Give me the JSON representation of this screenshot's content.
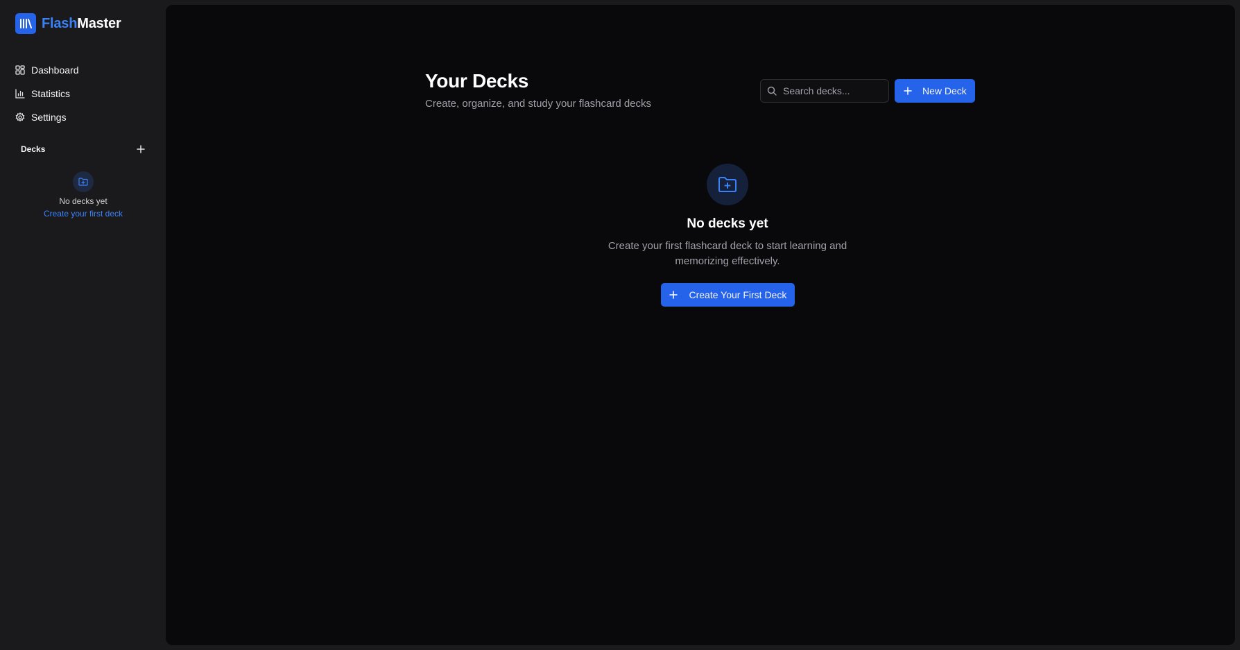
{
  "brand": {
    "name_accent": "Flash",
    "name_rest": "Master",
    "logo_icon": "library-icon",
    "accent_color": "#2563eb"
  },
  "nav": {
    "items": [
      {
        "label": "Dashboard",
        "icon": "dashboard-icon"
      },
      {
        "label": "Statistics",
        "icon": "bar-chart-icon"
      },
      {
        "label": "Settings",
        "icon": "gear-icon"
      }
    ]
  },
  "sidebar_decks": {
    "title": "Decks",
    "add_icon": "plus-icon",
    "empty_icon": "folder-plus-icon",
    "empty_text": "No decks yet",
    "empty_link": "Create your first deck"
  },
  "main": {
    "title": "Your Decks",
    "subtitle": "Create, organize, and study your flashcard decks",
    "search": {
      "placeholder": "Search decks...",
      "value": "",
      "icon": "search-icon"
    },
    "new_deck_label": "New Deck",
    "empty_state": {
      "icon": "folder-plus-icon",
      "title": "No decks yet",
      "description": "Create your first flashcard deck to start learning and memorizing effectively.",
      "button_label": "Create Your First Deck"
    }
  },
  "colors": {
    "background": "#09090b",
    "sidebar": "#1a1a1d",
    "primary": "#2563eb",
    "link": "#3b82f6",
    "muted_text": "#a1a1aa"
  }
}
